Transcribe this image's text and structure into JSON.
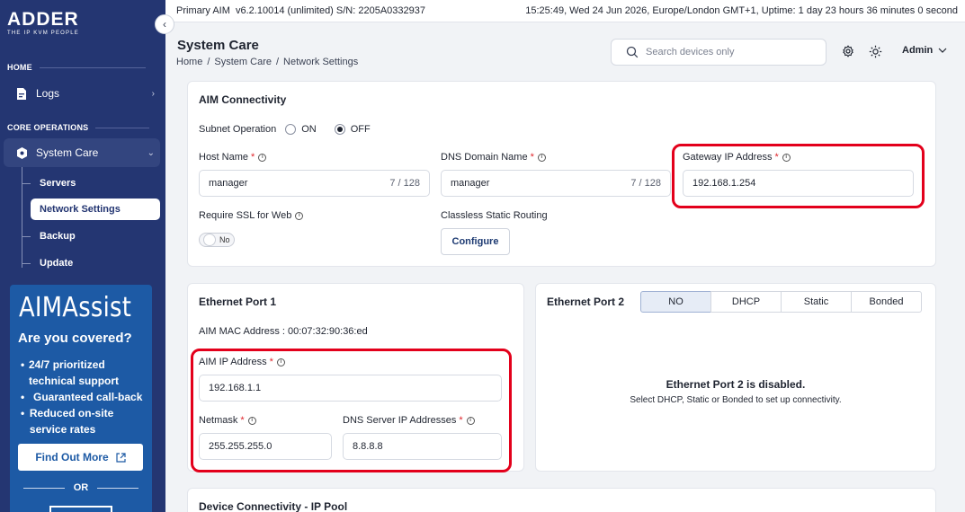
{
  "brand": {
    "name": "ADDER",
    "tagline": "THE IP KVM PEOPLE"
  },
  "topbar": {
    "left": "Primary AIM  v6.2.10014 (unlimited) S/N: 2205A0332937",
    "right": "15:25:49, Wed 24 Jun 2026, Europe/London GMT+1, Uptime: 1 day 23 hours 36 minutes 0 second"
  },
  "sidebar": {
    "section_home": "HOME",
    "logs": "Logs",
    "section_core": "CORE OPERATIONS",
    "system_care": "System Care",
    "sub": [
      "Servers",
      "Network Settings",
      "Backup",
      "Update"
    ],
    "active_sub": "Network Settings"
  },
  "promo": {
    "title": "AIMAssist",
    "question": "Are you covered?",
    "bullets": [
      "24/7 prioritized technical support",
      "Guaranteed call-back",
      "Reduced on-site service rates"
    ],
    "button": "Find Out More",
    "or": "OR"
  },
  "header": {
    "title": "System Care",
    "breadcrumb": [
      "Home",
      "/",
      "System Care",
      "/",
      "Network Settings"
    ],
    "search_placeholder": "Search devices only",
    "user": "Admin"
  },
  "aim_connectivity": {
    "title": "AIM Connectivity",
    "subnet_label": "Subnet Operation",
    "subnet_on": "ON",
    "subnet_off": "OFF",
    "host_label": "Host Name",
    "host_value": "manager",
    "host_count": "7 / 128",
    "dns_label": "DNS Domain Name",
    "dns_value": "manager",
    "dns_count": "7 / 128",
    "gateway_label": "Gateway IP Address",
    "gateway_value": "192.168.1.254",
    "ssl_label": "Require SSL for Web",
    "ssl_value": "No",
    "routing_label": "Classless Static Routing",
    "configure": "Configure"
  },
  "eth1": {
    "title": "Ethernet Port 1",
    "mac": "AIM MAC Address : 00:07:32:90:36:ed",
    "ip_label": "AIM IP Address",
    "ip_value": "192.168.1.1",
    "netmask_label": "Netmask",
    "netmask_value": "255.255.255.0",
    "dns_label": "DNS Server IP Addresses",
    "dns_value": "8.8.8.8"
  },
  "eth2": {
    "title": "Ethernet Port 2",
    "options": [
      "NO",
      "DHCP",
      "Static",
      "Bonded"
    ],
    "selected": "NO",
    "disabled_title": "Ethernet Port 2 is disabled.",
    "disabled_sub": "Select DHCP, Static or Bonded to set up connectivity."
  },
  "bottom_card": {
    "title": "Device Connectivity - IP Pool"
  },
  "colors": {
    "sidebar": "#243672",
    "promo": "#1d5aa5",
    "highlight": "#e3001b",
    "required": "#e0262c"
  }
}
